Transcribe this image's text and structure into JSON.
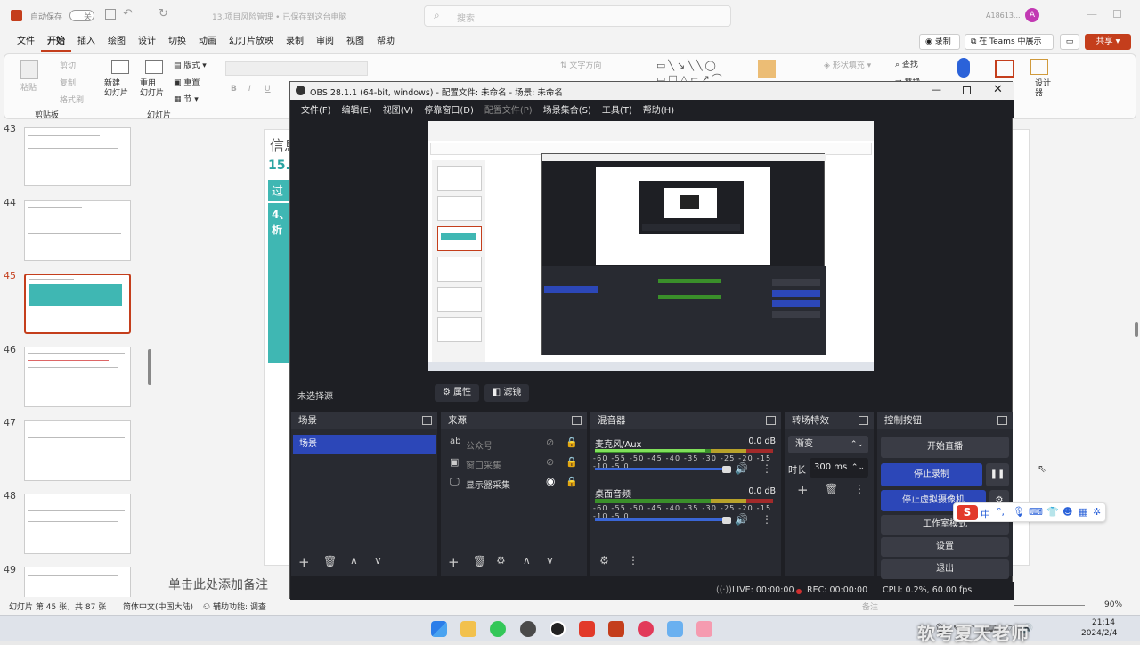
{
  "ppt": {
    "autosave_label": "自动保存",
    "autosave_state": "关",
    "doc_title": "13.项目风险管理 • 已保存到这台电脑",
    "search_placeholder": "搜索",
    "user_name": "A18613...",
    "user_initial": "A",
    "menu": [
      "文件",
      "开始",
      "插入",
      "绘图",
      "设计",
      "切换",
      "动画",
      "幻灯片放映",
      "录制",
      "审阅",
      "视图",
      "帮助"
    ],
    "record_btn": "录制",
    "teams_btn": "在 Teams 中展示",
    "share_btn": "共享",
    "ribbon": {
      "paste": "粘贴",
      "cut": "剪切",
      "copy": "复制",
      "format_painter": "格式刷",
      "clipboard": "剪贴板",
      "new_slide": "新建\n幻灯片",
      "reuse_slide": "重用\n幻灯片",
      "layout": "版式",
      "reset": "重置",
      "section": "节",
      "slides_group": "幻灯片",
      "text_direction": "文字方向",
      "shape_fill": "形状填充",
      "find": "查找",
      "replace": "替换",
      "designer": "设计\n器"
    },
    "thumbs": [
      "43",
      "44",
      "45",
      "46",
      "47",
      "48",
      "49"
    ],
    "slide_text": {
      "title": "信息",
      "num": "15.0",
      "box1": "过程",
      "box2": "4、\n析"
    },
    "notes_placeholder": "单击此处添加备注",
    "status": {
      "slide_info": "幻灯片 第 45 张，共 87 张",
      "lang": "简体中文(中国大陆)",
      "accessibility": "辅助功能: 调查",
      "notes": "备注",
      "zoom": "90%"
    }
  },
  "obs": {
    "title": "OBS 28.1.1 (64-bit, windows) - 配置文件: 未命名 - 场景: 未命名",
    "menu": [
      {
        "label": "文件(F)",
        "disabled": false
      },
      {
        "label": "编辑(E)",
        "disabled": false
      },
      {
        "label": "视图(V)",
        "disabled": false
      },
      {
        "label": "停靠窗口(D)",
        "disabled": false
      },
      {
        "label": "配置文件(P)",
        "disabled": true
      },
      {
        "label": "场景集合(S)",
        "disabled": false
      },
      {
        "label": "工具(T)",
        "disabled": false
      },
      {
        "label": "帮助(H)",
        "disabled": false
      }
    ],
    "no_source": "未选择源",
    "properties_btn": "属性",
    "filters_btn": "滤镜",
    "panels": {
      "scenes": "场景",
      "sources": "来源",
      "mixer": "混音器",
      "transitions": "转场特效",
      "controls": "控制按钮"
    },
    "scene_item": "场景",
    "sources": [
      {
        "name": "公众号",
        "visible": false
      },
      {
        "name": "窗口采集",
        "visible": false
      },
      {
        "name": "显示器采集",
        "visible": true
      }
    ],
    "mixer": [
      {
        "name": "麦克风/Aux",
        "db": "0.0 dB",
        "level": 0.62
      },
      {
        "name": "桌面音频",
        "db": "0.0 dB",
        "level": 0.0
      }
    ],
    "mixer_scale": "-60 -55 -50 -45 -40 -35 -30 -25 -20 -15 -10 -5 0",
    "transition": "渐变",
    "duration_label": "时长",
    "duration_value": "300 ms",
    "controls": {
      "start_stream": "开始直播",
      "stop_record": "停止录制",
      "stop_virtual_cam": "停止虚拟摄像机",
      "studio_mode": "工作室模式",
      "settings": "设置",
      "exit": "退出"
    },
    "status": {
      "live": "LIVE: 00:00:00",
      "rec": "REC: 00:00:00",
      "cpu": "CPU: 0.2%, 60.00 fps"
    }
  },
  "sogou": {
    "lang": "中"
  },
  "taskbar": {
    "time": "21:14",
    "date": "2024/2/4"
  },
  "watermark": "软考夏天老师"
}
